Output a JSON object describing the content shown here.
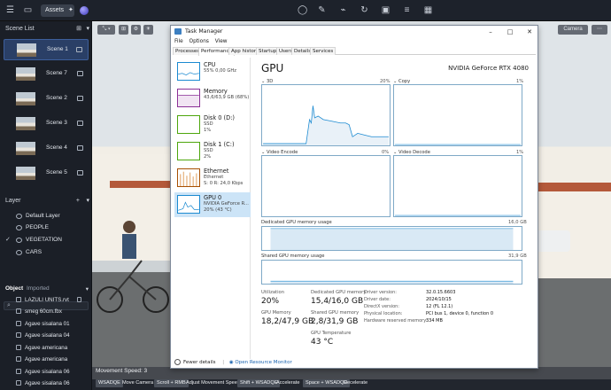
{
  "topbar": {
    "assets_label": "Assets"
  },
  "sidebar": {
    "scene_list_title": "Scene List",
    "scenes": [
      "Scene 1",
      "Scene 7",
      "Scene 2",
      "Scene 3",
      "Scene 4",
      "Scene 5"
    ],
    "layer_title": "Layer",
    "layers": [
      "Default Layer",
      "PEOPLE",
      "VEGETATION",
      "CARS"
    ],
    "object_tab": "Object",
    "imported_tab": "Imported",
    "objects": [
      "LAZULI UNITS.rvt",
      "smeg 60cm.fbx",
      "Agave sisalana 01",
      "Agave sisalana 04",
      "Agave americana",
      "Agave americana",
      "Agave sisalana 06",
      "Agave sisalana 06"
    ]
  },
  "viewport": {
    "camera_label": "Camera"
  },
  "bottom": {
    "movement_speed": "Movement Speed: 3",
    "hints": [
      {
        "key": "WSADQE",
        "text": "Move Camera"
      },
      {
        "key": "Scroll + RMB",
        "text": "Adjust Movement Speed"
      },
      {
        "key": "Shift + WSADQE",
        "text": "Accelerate"
      },
      {
        "key": "Space + WSADQE",
        "text": "Decelerate"
      }
    ]
  },
  "task_manager": {
    "title": "Task Manager",
    "menu": [
      "File",
      "Options",
      "View"
    ],
    "tabs": [
      "Processes",
      "Performance",
      "App history",
      "Startup",
      "Users",
      "Details",
      "Services"
    ],
    "active_tab": "Performance",
    "sidebar": [
      {
        "name": "CPU",
        "sub": "55% 0,00 GHz"
      },
      {
        "name": "Memory",
        "sub": "43,6/63,9 GB (68%)"
      },
      {
        "name": "Disk 0 (D:)",
        "sub": "SSD",
        "sub2": "1%"
      },
      {
        "name": "Disk 1 (C:)",
        "sub": "SSD",
        "sub2": "2%"
      },
      {
        "name": "Ethernet",
        "sub": "Ethernet",
        "sub2": "S: 0 R: 24,0 Kbps"
      },
      {
        "name": "GPU 0",
        "sub": "NVIDIA GeForce R...",
        "sub2": "20% (43 °C)"
      }
    ],
    "gpu": {
      "heading": "GPU",
      "model": "NVIDIA GeForce RTX 4080",
      "graphs": [
        {
          "label": "3D",
          "pct": "20%"
        },
        {
          "label": "Copy",
          "pct": "1%"
        },
        {
          "label": "Video Encode",
          "pct": "0%"
        },
        {
          "label": "Video Decode",
          "pct": "1%"
        }
      ],
      "dedicated_label": "Dedicated GPU memory usage",
      "dedicated_max": "16,0 GB",
      "shared_label": "Shared GPU memory usage",
      "shared_max": "31,9 GB",
      "stats": {
        "utilization_k": "Utilization",
        "utilization_v": "20%",
        "dedicated_k": "Dedicated GPU memory",
        "dedicated_v": "15,4/16,0 GB",
        "gpu_memory_k": "GPU Memory",
        "gpu_memory_v": "18,2/47,9 GB",
        "shared_k": "Shared GPU memory",
        "shared_v": "2,8/31,9 GB",
        "temp_k": "GPU Temperature",
        "temp_v": "43 °C"
      },
      "info": [
        {
          "k": "Driver version:",
          "v": "32.0.15.6603"
        },
        {
          "k": "Driver date:",
          "v": "2024/10/15"
        },
        {
          "k": "DirectX version:",
          "v": "12 (FL 12.1)"
        },
        {
          "k": "Physical location:",
          "v": "PCI bus 1, device 0, function 0"
        },
        {
          "k": "Hardware reserved memory:",
          "v": "334 MB"
        }
      ]
    },
    "footer": {
      "fewer": "Fewer details",
      "monitor": "Open Resource Monitor"
    }
  }
}
